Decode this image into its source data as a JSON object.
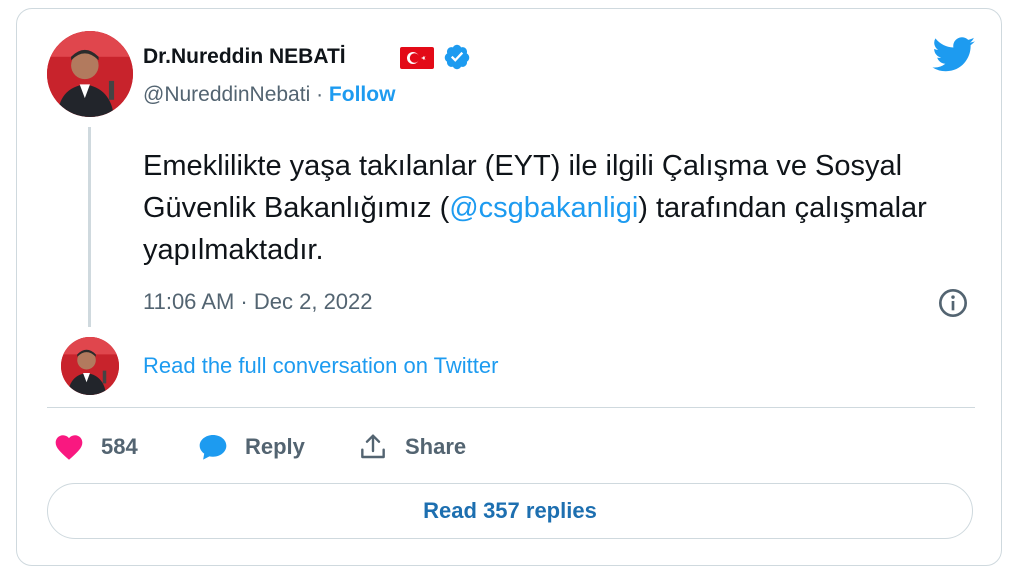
{
  "author": {
    "name": "Dr.Nureddin NEBATİ",
    "handle": "@NureddinNebati",
    "separator": " · ",
    "follow_label": "Follow",
    "verified": true,
    "flag": "turkey-flag"
  },
  "tweet": {
    "text_before": "Emeklilikte yaşa takılanlar (EYT) ile ilgili Çalışma ve Sosyal Güvenlik Bakanlığımız (",
    "mention": "@csgbakanligi",
    "text_after": ") tarafından çalışmalar yapılmaktadır.",
    "timestamp": "11:06 AM · Dec 2, 2022"
  },
  "conversation_link": "Read the full conversation on Twitter",
  "actions": {
    "likes": "584",
    "reply_label": "Reply",
    "share_label": "Share"
  },
  "read_replies_label": "Read 357 replies",
  "colors": {
    "accent": "#1d9bf0",
    "like": "#f91880",
    "text": "#0f1419",
    "secondary": "#536471",
    "avatar_bg": "#c8232c"
  },
  "icons": {
    "logo": "twitter-bird-icon",
    "info": "info-icon",
    "like": "heart-icon",
    "reply": "speech-bubble-icon",
    "share": "share-upload-icon",
    "verified": "verified-badge-icon"
  }
}
